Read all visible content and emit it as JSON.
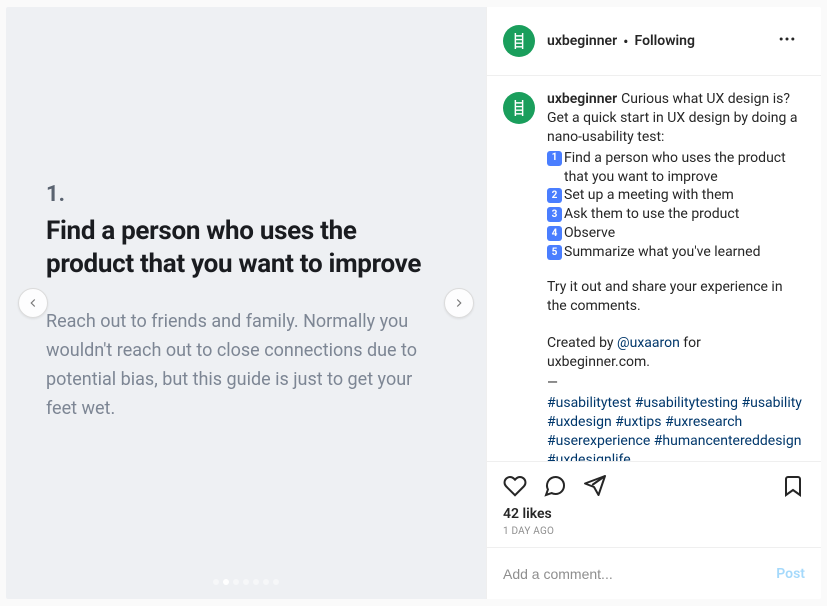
{
  "slide": {
    "number": "1.",
    "title": "Find a person who uses the product that you want to improve",
    "body": "Reach out to friends and family. Normally you wouldn't reach out to close connections due to potential bias, but this guide is just to get your feet wet."
  },
  "header": {
    "username": "uxbeginner",
    "separator": "•",
    "follow_state": "Following"
  },
  "caption": {
    "username": "uxbeginner",
    "intro": "Curious what UX design is? Get a quick start in UX design by doing a nano-usability test:",
    "steps": [
      {
        "num": "1",
        "text": "Find a person who uses the product that you want to improve"
      },
      {
        "num": "2",
        "text": "Set up a meeting with them"
      },
      {
        "num": "3",
        "text": "Ask them to use the product"
      },
      {
        "num": "4",
        "text": "Observe"
      },
      {
        "num": "5",
        "text": "Summarize what you've learned"
      }
    ],
    "tryout": "Try it out and share your experience in the comments.",
    "credit_prefix": "Created by ",
    "credit_mention": "@uxaaron",
    "credit_suffix": " for uxbeginner.com.",
    "dash": "—",
    "hashtags": "#usabilitytest #usabilitytesting #usability #uxdesign #uxtips #uxresearch #userexperience #humancentereddesign #uxdesignlife"
  },
  "meta": {
    "likes": "42 likes",
    "timestamp": "1 DAY AGO"
  },
  "comment": {
    "placeholder": "Add a comment...",
    "post_label": "Post"
  }
}
